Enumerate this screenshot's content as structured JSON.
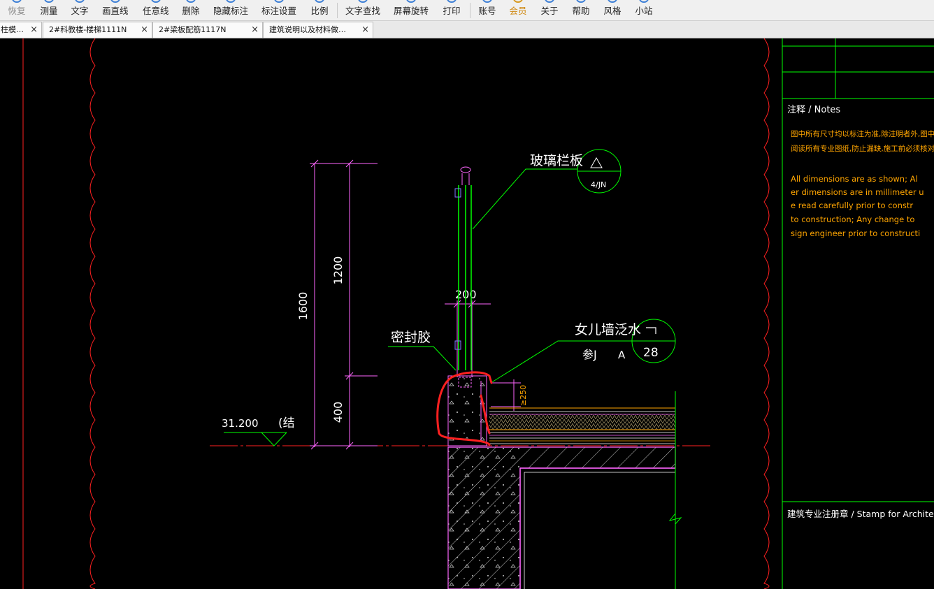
{
  "toolbar": {
    "items": [
      {
        "label": "恢复",
        "name": "redo-button",
        "state": "disabled"
      },
      {
        "label": "测量",
        "name": "measure-button"
      },
      {
        "label": "文字",
        "name": "text-button"
      },
      {
        "label": "画直线",
        "name": "draw-line-button"
      },
      {
        "label": "任意线",
        "name": "freehand-line-button"
      },
      {
        "label": "删除",
        "name": "delete-button"
      },
      {
        "label": "隐藏标注",
        "name": "hide-annotations-button"
      },
      {
        "label": "标注设置",
        "name": "annotation-settings-button"
      },
      {
        "label": "比例",
        "name": "scale-button"
      },
      {
        "label": "文字查找",
        "name": "text-search-button"
      },
      {
        "label": "屏幕旋转",
        "name": "rotate-screen-button"
      },
      {
        "label": "打印",
        "name": "print-button"
      },
      {
        "label": "账号",
        "name": "account-button"
      },
      {
        "label": "会员",
        "name": "membership-button",
        "state": "vip"
      },
      {
        "label": "关于",
        "name": "about-button"
      },
      {
        "label": "帮助",
        "name": "help-button"
      },
      {
        "label": "风格",
        "name": "style-button"
      },
      {
        "label": "小站",
        "name": "mini-site-button"
      }
    ]
  },
  "tabs": [
    {
      "label": "柱模…",
      "close": "×"
    },
    {
      "label": "2#科教楼-楼梯1111N",
      "close": "×"
    },
    {
      "label": "2#梁板配筋1117N",
      "close": "×"
    },
    {
      "label": "建筑说明以及材料做…",
      "close": "×"
    }
  ],
  "drawing": {
    "colors": {
      "background": "#000000",
      "border": "#ff2020",
      "frame": "#00ff00",
      "dimension": "#ff66ff",
      "text": "#ffffff",
      "notes": "#ffa500",
      "markup": "#ff2020"
    },
    "labels": {
      "glass_panel": "玻璃栏板",
      "glass_ref": "4/JN",
      "sealant": "密封胶",
      "parapet": "女儿墙泛水",
      "parapet_ref_prefix": "参J",
      "parapet_ref_suffix": "A",
      "parapet_ref_num": "28",
      "elevation": "31.200",
      "elevation_note": "(结",
      "dim_total": "1600",
      "dim_upper": "1200",
      "dim_lower": "400",
      "dim_width": "200",
      "dim_upturn": "≥250"
    },
    "notes": {
      "header": "注释 / Notes",
      "cn_lines": [
        "图中所有尺寸均以标注为准,除注明者外,图中标",
        "阅读所有专业图纸,防止漏缺,施工前必须核对尺"
      ],
      "en_lines": [
        "All dimensions are as shown; Al",
        "er dimensions are in millimeter u",
        "e read carefully prior to constr",
        " to construction; Any change to",
        "sign engineer prior to constructi"
      ],
      "stamp": "建筑专业注册章 / Stamp for Archite"
    }
  }
}
